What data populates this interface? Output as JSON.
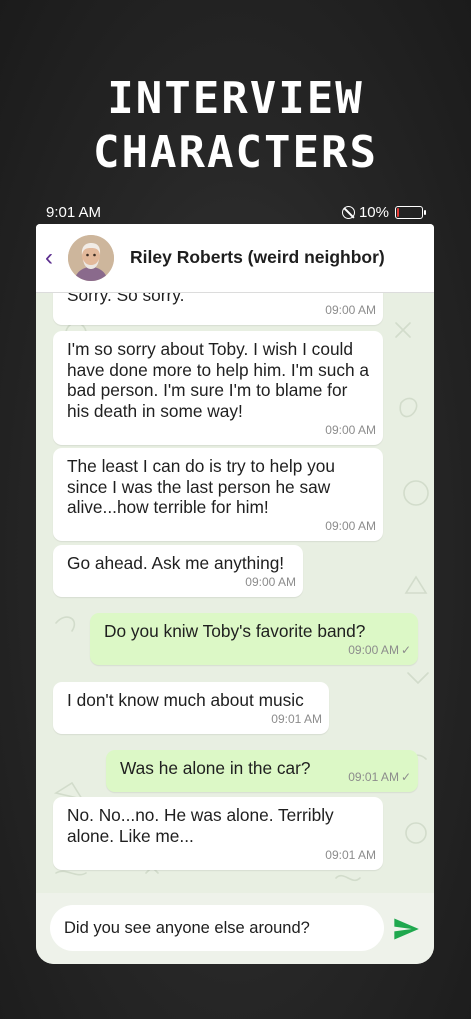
{
  "promo": {
    "title_line1": "INTERVIEW",
    "title_line2": "CHARACTERS"
  },
  "status_bar": {
    "time": "9:01 AM",
    "battery_percent": "10%",
    "battery_level": 0.1,
    "battery_color": "#e53935"
  },
  "header": {
    "back_icon": "chevron-left-icon",
    "contact_name": "Riley Roberts (weird neighbor)",
    "accent_color": "#5b2d8e"
  },
  "messages": [
    {
      "direction": "in",
      "text": "Sorry. So sorry.",
      "time": "09:00 AM"
    },
    {
      "direction": "in",
      "text": "I'm so sorry about Toby. I wish I could have done more to help him. I'm such a bad person. I'm sure I'm to blame for his death in some way!",
      "time": "09:00 AM"
    },
    {
      "direction": "in",
      "text": "The least I can do is try to help you since I was the last person he saw alive...how terrible for him!",
      "time": "09:00 AM"
    },
    {
      "direction": "in",
      "text": "Go ahead. Ask me anything!",
      "time": "09:00 AM"
    },
    {
      "direction": "out",
      "text": "Do you kniw Toby's favorite band?",
      "time": "09:00 AM",
      "read": true
    },
    {
      "direction": "in",
      "text": "I don't know much about music",
      "time": "09:01 AM"
    },
    {
      "direction": "out",
      "text": "Was he alone in the car?",
      "time": "09:01 AM",
      "read": true
    },
    {
      "direction": "in",
      "text": "No. No...no. He was alone. Terribly alone. Like me...",
      "time": "09:01 AM"
    }
  ],
  "composer": {
    "value": "Did you see anyone else around?",
    "send_icon": "send-icon",
    "send_color": "#1fa84e"
  },
  "colors": {
    "incoming_bubble": "#ffffff",
    "outgoing_bubble": "#dcf8c6",
    "chat_background": "#e8efe2"
  }
}
